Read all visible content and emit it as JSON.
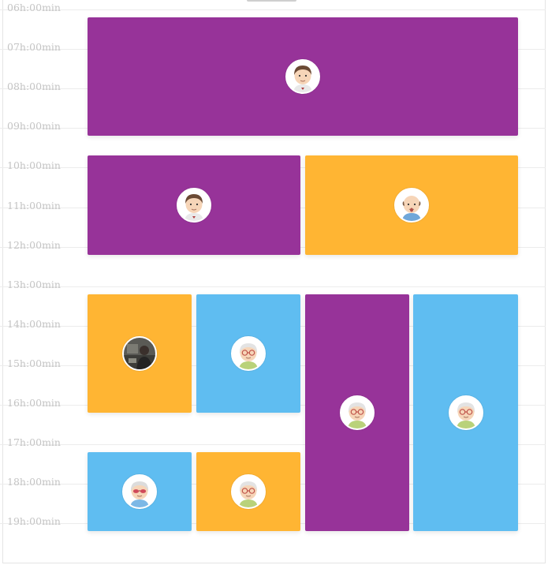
{
  "calendar": {
    "time_labels": [
      "06h:00min",
      "07h:00min",
      "08h:00min",
      "09h:00min",
      "10h:00min",
      "11h:00min",
      "12h:00min",
      "13h:00min",
      "14h:00min",
      "15h:00min",
      "16h:00min",
      "17h:00min",
      "18h:00min",
      "19h:00min"
    ],
    "colors": {
      "purple": "#973399",
      "orange": "#ffb533",
      "blue": "#5fbdf1"
    },
    "events": [
      {
        "start": "06h:00min",
        "end": "09h:00min",
        "color": "purple",
        "avatar_icon": "person-brown-hair-avatar-icon"
      },
      {
        "start": "09h:30min",
        "end": "12h:00min",
        "color": "purple",
        "avatar_icon": "person-brown-hair-avatar-icon"
      },
      {
        "start": "09h:30min",
        "end": "12h:00min",
        "color": "orange",
        "avatar_icon": "bald-person-avatar-icon"
      },
      {
        "start": "13h:00min",
        "end": "16h:00min",
        "color": "orange",
        "avatar_icon": "photo-person-avatar-icon"
      },
      {
        "start": "13h:00min",
        "end": "16h:00min",
        "color": "blue",
        "avatar_icon": "person-glasses-avatar-icon"
      },
      {
        "start": "13h:00min",
        "end": "19h:00min",
        "color": "purple",
        "avatar_icon": "person-glasses-avatar-icon"
      },
      {
        "start": "13h:00min",
        "end": "19h:00min",
        "color": "blue",
        "avatar_icon": "person-glasses-avatar-icon"
      },
      {
        "start": "17h:00min",
        "end": "19h:00min",
        "color": "blue",
        "avatar_icon": "person-sunglasses-avatar-icon"
      },
      {
        "start": "17h:00min",
        "end": "19h:00min",
        "color": "orange",
        "avatar_icon": "person-glasses-avatar-icon"
      }
    ]
  }
}
